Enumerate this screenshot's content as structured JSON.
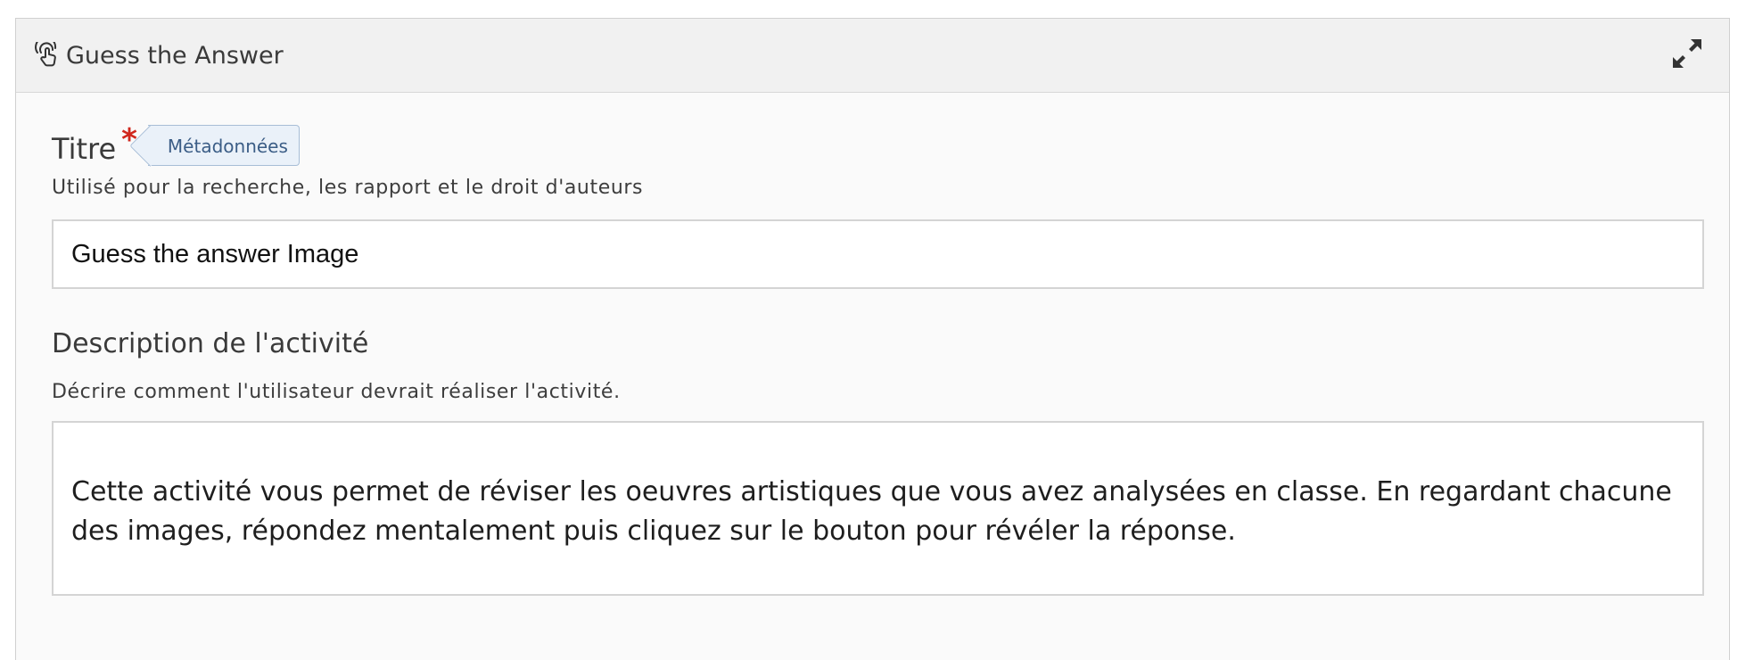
{
  "header": {
    "title": "Guess the Answer",
    "icon": "pointer-hand-icon",
    "expand_icon": "expand-arrows-icon"
  },
  "title_field": {
    "label": "Titre",
    "required_marker": "*",
    "metadata_tag": "Métadonnées",
    "description": "Utilisé pour la recherche, les rapport et le droit d'auteurs",
    "value": "Guess the answer Image"
  },
  "description_field": {
    "label": "Description de l'activité",
    "description": "Décrire comment l'utilisateur devrait réaliser l'activité.",
    "value": "Cette activité vous permet de réviser les oeuvres artistiques que vous avez analysées en classe. En regardant chacune des images, répondez mentalement puis cliquez sur le bouton pour révéler la réponse."
  },
  "colors": {
    "required": "#d0271d",
    "tag_bg": "#eaf1f9",
    "tag_text": "#3b5d86"
  }
}
